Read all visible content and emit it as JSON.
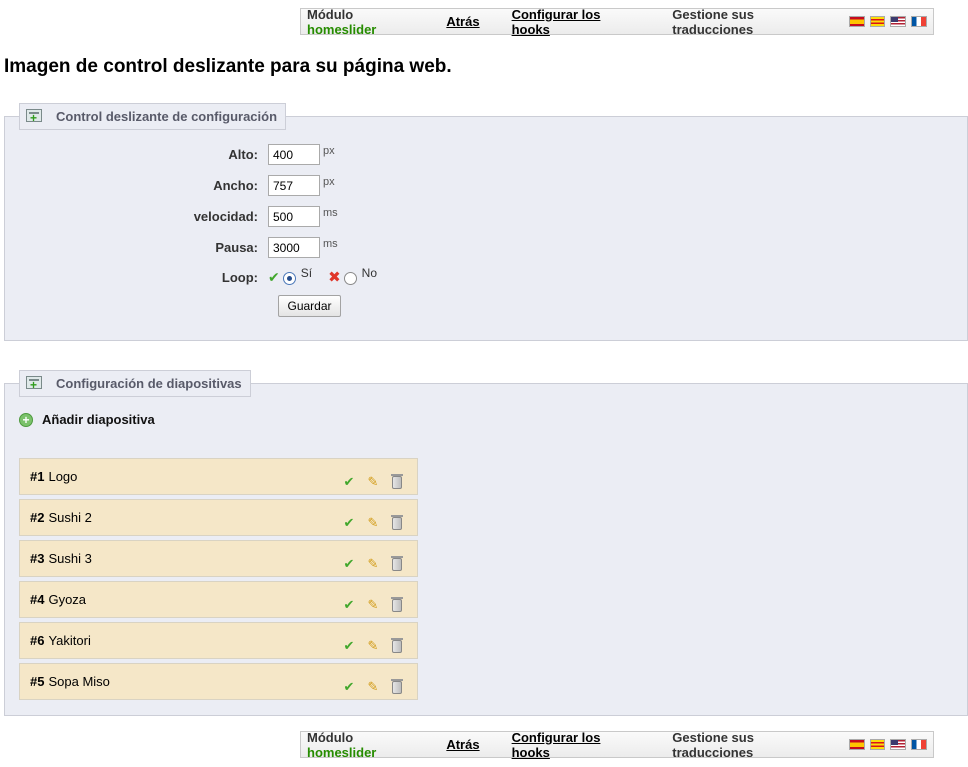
{
  "toolbar": {
    "module_prefix": "Módulo",
    "module_name": "homeslider",
    "back": "Atrás",
    "hooks": "Configurar los hooks",
    "translations": "Gestione sus traducciones",
    "flags": [
      "es-flag-icon",
      "ca-flag-icon",
      "en-flag-icon",
      "fr-flag-icon"
    ]
  },
  "page": {
    "title": "Imagen de control deslizante para su página web."
  },
  "config": {
    "legend": "Control deslizante de configuración",
    "fields": {
      "height": {
        "label": "Alto:",
        "value": "400",
        "unit": "px"
      },
      "width": {
        "label": "Ancho:",
        "value": "757",
        "unit": "px"
      },
      "speed": {
        "label": "velocidad:",
        "value": "500",
        "unit": "ms"
      },
      "pause": {
        "label": "Pausa:",
        "value": "3000",
        "unit": "ms"
      }
    },
    "loop": {
      "label": "Loop:",
      "yes": "Sí",
      "no": "No",
      "selected": "yes"
    },
    "save": "Guardar"
  },
  "slides_section": {
    "legend": "Configuración de diapositivas",
    "add": "Añadir diapositiva",
    "slides": [
      {
        "num": "#1",
        "name": "Logo"
      },
      {
        "num": "#2",
        "name": "Sushi 2"
      },
      {
        "num": "#3",
        "name": "Sushi 3"
      },
      {
        "num": "#4",
        "name": "Gyoza"
      },
      {
        "num": "#6",
        "name": "Yakitori"
      },
      {
        "num": "#5",
        "name": "Sopa Miso"
      }
    ]
  },
  "colors": {
    "module_name": "#268c00",
    "panel_bg": "#ebedf4",
    "slide_bg": "#f5e7c8"
  }
}
